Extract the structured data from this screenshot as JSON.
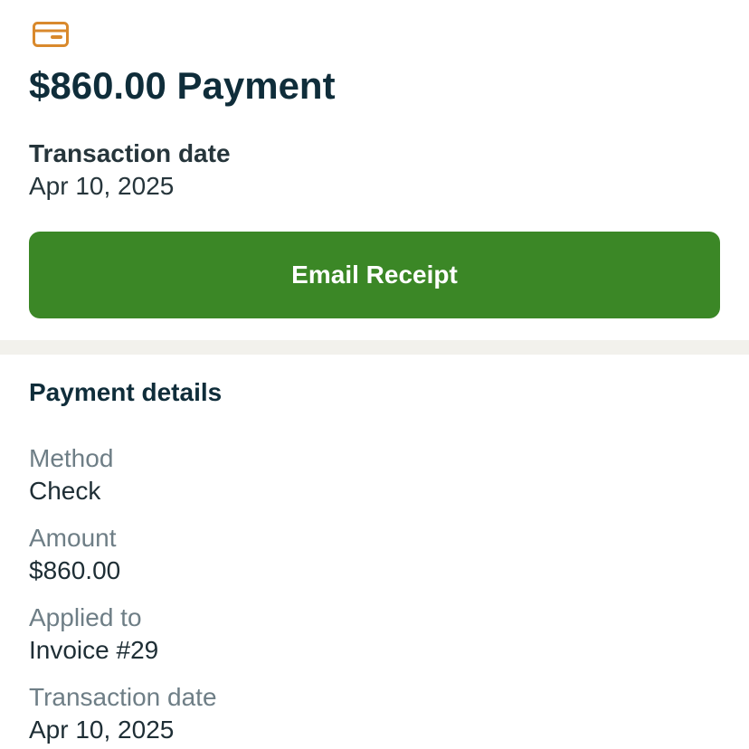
{
  "header": {
    "icon": "credit-card-icon",
    "icon_color": "#d9892c",
    "title": "$860.00 Payment"
  },
  "summary": {
    "date_label": "Transaction date",
    "date_value": "Apr 10, 2025"
  },
  "actions": {
    "email_receipt_label": "Email Receipt",
    "button_color": "#3b8726"
  },
  "details": {
    "title": "Payment details",
    "items": [
      {
        "label": "Method",
        "value": "Check"
      },
      {
        "label": "Amount",
        "value": "$860.00"
      },
      {
        "label": "Applied to",
        "value": "Invoice #29"
      },
      {
        "label": "Transaction date",
        "value": "Apr 10, 2025"
      }
    ]
  }
}
